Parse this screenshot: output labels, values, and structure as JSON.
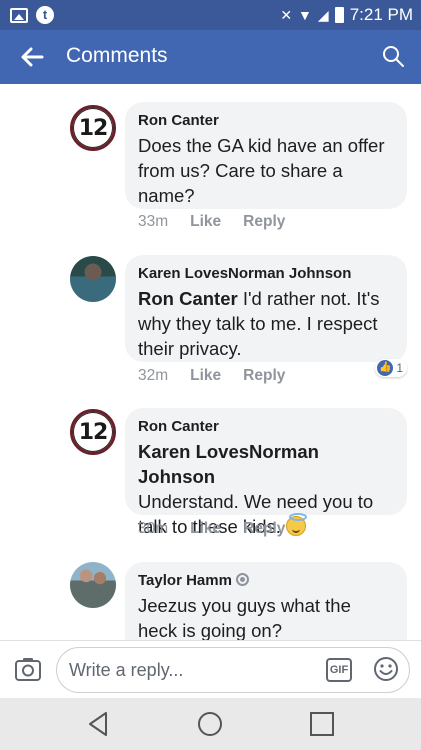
{
  "status_bar": {
    "time": "7:21 PM",
    "notification_app_letter": "t"
  },
  "header": {
    "title": "Comments"
  },
  "comments": [
    {
      "author": "Ron Canter",
      "text": "Does the GA kid have an offer from us? Care to share a name?",
      "time": "33m",
      "like_label": "Like",
      "reply_label": "Reply",
      "avatar_label": "12"
    },
    {
      "author": "Karen LovesNorman Johnson",
      "mention": "Ron Canter",
      "text": " I'd rather not. It's why they talk to me. I respect their privacy.",
      "time": "32m",
      "like_label": "Like",
      "reply_label": "Reply",
      "reaction_count": "1"
    },
    {
      "author": "Ron Canter",
      "mention": "Karen LovesNorman Johnson",
      "text": "Understand. We need you to talk to these kids. ",
      "time": "30m",
      "like_label": "Like",
      "reply_label": "Reply",
      "avatar_label": "12"
    },
    {
      "author": "Taylor Hamm",
      "text": "Jeezus you guys what the heck is going on?"
    }
  ],
  "composer": {
    "placeholder": "Write a reply...",
    "gif_label": "GIF"
  },
  "colors": {
    "brand": "#4267b2",
    "status_bar": "#3b5998",
    "bubble": "#f2f3f5",
    "meta_text": "#90949c"
  }
}
